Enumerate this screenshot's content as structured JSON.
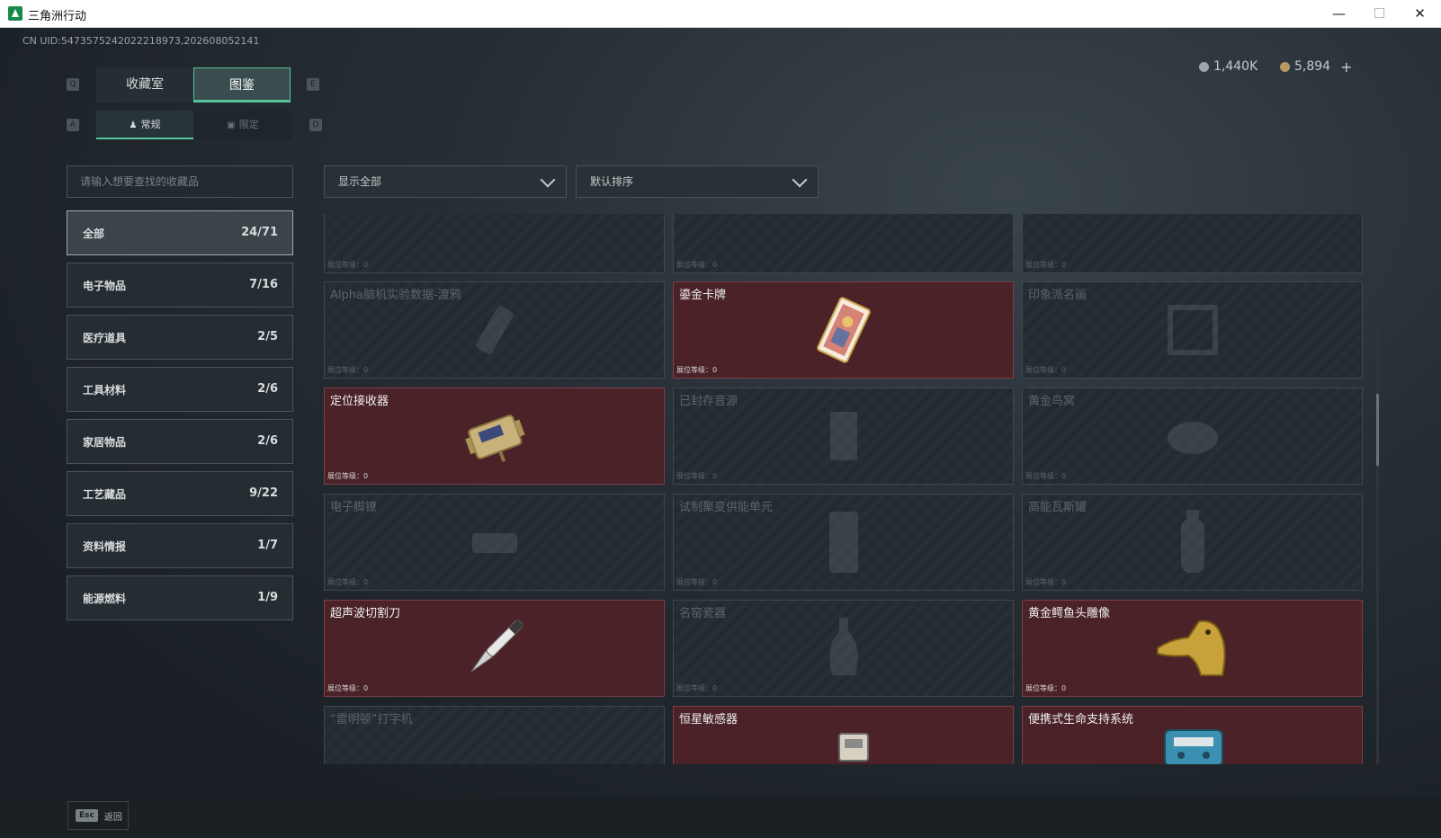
{
  "window": {
    "title": "三角洲行动"
  },
  "uid_text": "CN UID:5473575242022218973,202608052141",
  "currency": [
    {
      "icon": "silver-coin-icon",
      "value": "1,440K"
    },
    {
      "icon": "gold-coin-icon",
      "value": "5,894",
      "plus": "+"
    }
  ],
  "key_hints": {
    "tab_left": "Q",
    "tab_right": "E",
    "sub_left": "A",
    "sub_right": "D"
  },
  "tabs": [
    {
      "label": "收藏室",
      "active": false
    },
    {
      "label": "图鉴",
      "active": true
    }
  ],
  "subtabs": [
    {
      "label": "常规",
      "icon": "figure-icon",
      "active": true
    },
    {
      "label": "限定",
      "icon": "image-icon",
      "active": false
    }
  ],
  "search": {
    "placeholder": "请输入想要查找的收藏品"
  },
  "filters": {
    "display": "显示全部",
    "sort": "默认排序"
  },
  "categories": [
    {
      "name": "全部",
      "count": "24/71",
      "active": true
    },
    {
      "name": "电子物品",
      "count": "7/16"
    },
    {
      "name": "医疗道具",
      "count": "2/5"
    },
    {
      "name": "工具材料",
      "count": "2/6"
    },
    {
      "name": "家居物品",
      "count": "2/6"
    },
    {
      "name": "工艺藏品",
      "count": "9/22"
    },
    {
      "name": "资料情报",
      "count": "1/7"
    },
    {
      "name": "能源燃料",
      "count": "1/9"
    }
  ],
  "level_label": "展位等级：0",
  "cards": [
    {
      "name": "",
      "owned": false,
      "item_icon": "relic-icon"
    },
    {
      "name": "",
      "owned": false,
      "item_icon": "relic-icon"
    },
    {
      "name": "",
      "owned": false,
      "item_icon": "relic-icon"
    },
    {
      "name": "Alpha脑机实验数据-渡鸦",
      "owned": false,
      "item_icon": "data-drive-icon"
    },
    {
      "name": "鎏金卡牌",
      "owned": true,
      "item_icon": "gilded-card-icon"
    },
    {
      "name": "印象派名画",
      "owned": false,
      "item_icon": "painting-icon"
    },
    {
      "name": "定位接收器",
      "owned": true,
      "item_icon": "receiver-icon"
    },
    {
      "name": "已封存音源",
      "owned": false,
      "item_icon": "audio-source-icon"
    },
    {
      "name": "黄金鸟窝",
      "owned": false,
      "item_icon": "bird-nest-icon"
    },
    {
      "name": "电子脚镣",
      "owned": false,
      "item_icon": "ankle-monitor-icon"
    },
    {
      "name": "试制聚变供能单元",
      "owned": false,
      "item_icon": "fusion-unit-icon"
    },
    {
      "name": "高能瓦斯罐",
      "owned": false,
      "item_icon": "gas-canister-icon"
    },
    {
      "name": "超声波切割刀",
      "owned": true,
      "item_icon": "ultrasonic-knife-icon"
    },
    {
      "name": "名窑瓷器",
      "owned": false,
      "item_icon": "porcelain-vase-icon"
    },
    {
      "name": "黄金鳄鱼头雕像",
      "owned": true,
      "item_icon": "gold-crocodile-icon"
    },
    {
      "name": "“雷明顿”打字机",
      "owned": false,
      "item_icon": "typewriter-icon"
    },
    {
      "name": "恒星敏感器",
      "owned": true,
      "item_icon": "star-sensor-icon"
    },
    {
      "name": "便携式生命支持系统",
      "owned": true,
      "item_icon": "life-support-icon"
    }
  ],
  "footer": {
    "key": "Esc",
    "label": "返回"
  }
}
